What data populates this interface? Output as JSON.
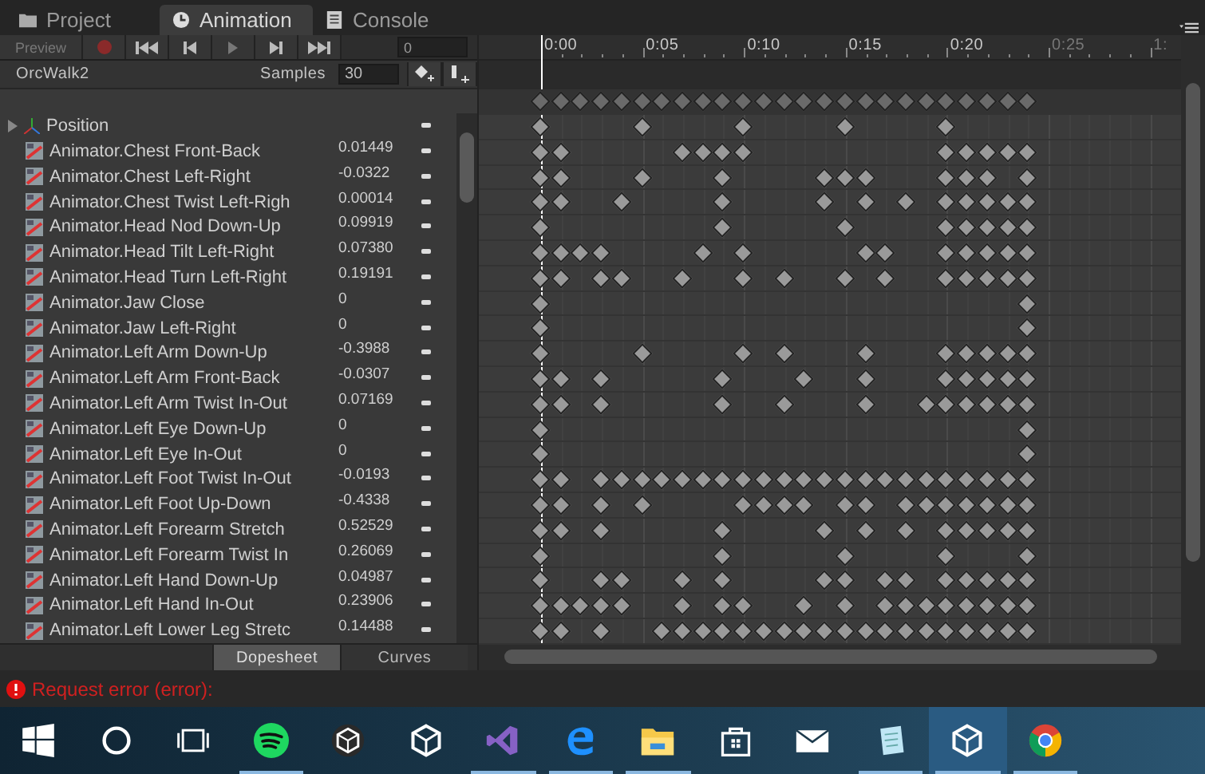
{
  "tabs": [
    {
      "label": "Project",
      "selected": false
    },
    {
      "label": "Animation",
      "selected": true
    },
    {
      "label": "Console",
      "selected": false
    }
  ],
  "toolbar": {
    "preview": "Preview",
    "frame": "0"
  },
  "clip": {
    "name": "OrcWalk2",
    "samples_label": "Samples",
    "samples": "30"
  },
  "ruler": [
    {
      "label": "0:00",
      "dim": false
    },
    {
      "label": "0:05",
      "dim": false
    },
    {
      "label": "0:10",
      "dim": false
    },
    {
      "label": "0:15",
      "dim": false
    },
    {
      "label": "0:20",
      "dim": false
    },
    {
      "label": "0:25",
      "dim": true
    },
    {
      "label": "1:",
      "dim": true
    }
  ],
  "summary_keys": [
    true,
    true,
    true,
    true,
    true,
    true,
    true,
    true,
    true,
    true,
    true,
    true,
    true,
    true,
    true,
    true,
    true,
    true,
    true,
    true,
    true,
    true,
    true,
    true,
    true
  ],
  "properties": [
    {
      "kind": "group",
      "name": "Position",
      "keys": [
        true,
        false,
        false,
        false,
        false,
        true,
        false,
        false,
        false,
        false,
        true,
        false,
        false,
        false,
        false,
        true,
        false,
        false,
        false,
        false,
        true,
        false,
        false,
        false,
        false
      ]
    },
    {
      "kind": "curve",
      "name": "Animator.Chest Front-Back",
      "value": "0.01449",
      "keys": [
        true,
        true,
        false,
        false,
        false,
        false,
        false,
        true,
        true,
        true,
        true,
        false,
        false,
        false,
        false,
        false,
        false,
        false,
        false,
        false,
        true,
        true,
        true,
        true,
        true
      ]
    },
    {
      "kind": "curve",
      "name": "Animator.Chest Left-Right",
      "value": "-0.0322",
      "keys": [
        true,
        true,
        false,
        false,
        false,
        true,
        false,
        false,
        false,
        true,
        false,
        false,
        false,
        false,
        true,
        true,
        true,
        false,
        false,
        false,
        true,
        true,
        true,
        false,
        true
      ]
    },
    {
      "kind": "curve",
      "name": "Animator.Chest Twist Left-Righ",
      "value": "0.00014",
      "keys": [
        true,
        true,
        false,
        false,
        true,
        false,
        false,
        false,
        false,
        true,
        false,
        false,
        false,
        false,
        true,
        false,
        true,
        false,
        true,
        false,
        true,
        true,
        true,
        true,
        true
      ]
    },
    {
      "kind": "curve",
      "name": "Animator.Head Nod Down-Up",
      "value": "0.09919",
      "keys": [
        true,
        false,
        false,
        false,
        false,
        false,
        false,
        false,
        false,
        true,
        false,
        false,
        false,
        false,
        false,
        true,
        false,
        false,
        false,
        false,
        true,
        true,
        true,
        true,
        true
      ]
    },
    {
      "kind": "curve",
      "name": "Animator.Head Tilt Left-Right",
      "value": "0.07380",
      "keys": [
        true,
        true,
        true,
        true,
        false,
        false,
        false,
        false,
        true,
        false,
        true,
        false,
        false,
        false,
        false,
        false,
        true,
        true,
        false,
        false,
        true,
        true,
        true,
        true,
        true
      ]
    },
    {
      "kind": "curve",
      "name": "Animator.Head Turn Left-Right",
      "value": "0.19191",
      "keys": [
        true,
        true,
        false,
        true,
        true,
        false,
        false,
        true,
        false,
        false,
        true,
        false,
        true,
        false,
        false,
        true,
        false,
        true,
        false,
        false,
        true,
        true,
        true,
        true,
        true
      ]
    },
    {
      "kind": "curve",
      "name": "Animator.Jaw Close",
      "value": "0",
      "keys": [
        true,
        false,
        false,
        false,
        false,
        false,
        false,
        false,
        false,
        false,
        false,
        false,
        false,
        false,
        false,
        false,
        false,
        false,
        false,
        false,
        false,
        false,
        false,
        false,
        true
      ]
    },
    {
      "kind": "curve",
      "name": "Animator.Jaw Left-Right",
      "value": "0",
      "keys": [
        true,
        false,
        false,
        false,
        false,
        false,
        false,
        false,
        false,
        false,
        false,
        false,
        false,
        false,
        false,
        false,
        false,
        false,
        false,
        false,
        false,
        false,
        false,
        false,
        true
      ]
    },
    {
      "kind": "curve",
      "name": "Animator.Left Arm Down-Up",
      "value": "-0.3988",
      "keys": [
        true,
        false,
        false,
        false,
        false,
        true,
        false,
        false,
        false,
        false,
        true,
        false,
        true,
        false,
        false,
        false,
        true,
        false,
        false,
        false,
        true,
        true,
        true,
        true,
        true
      ]
    },
    {
      "kind": "curve",
      "name": "Animator.Left Arm Front-Back",
      "value": "-0.0307",
      "keys": [
        true,
        true,
        false,
        true,
        false,
        false,
        false,
        false,
        false,
        true,
        false,
        false,
        false,
        true,
        false,
        false,
        true,
        false,
        false,
        false,
        true,
        true,
        true,
        true,
        true
      ]
    },
    {
      "kind": "curve",
      "name": "Animator.Left Arm Twist In-Out",
      "value": "0.07169",
      "keys": [
        true,
        true,
        false,
        true,
        false,
        false,
        false,
        false,
        false,
        true,
        false,
        false,
        true,
        false,
        false,
        false,
        true,
        false,
        false,
        true,
        true,
        true,
        true,
        true,
        true
      ]
    },
    {
      "kind": "curve",
      "name": "Animator.Left Eye Down-Up",
      "value": "0",
      "keys": [
        true,
        false,
        false,
        false,
        false,
        false,
        false,
        false,
        false,
        false,
        false,
        false,
        false,
        false,
        false,
        false,
        false,
        false,
        false,
        false,
        false,
        false,
        false,
        false,
        true
      ]
    },
    {
      "kind": "curve",
      "name": "Animator.Left Eye In-Out",
      "value": "0",
      "keys": [
        true,
        false,
        false,
        false,
        false,
        false,
        false,
        false,
        false,
        false,
        false,
        false,
        false,
        false,
        false,
        false,
        false,
        false,
        false,
        false,
        false,
        false,
        false,
        false,
        true
      ]
    },
    {
      "kind": "curve",
      "name": "Animator.Left Foot Twist In-Out",
      "value": "-0.0193",
      "keys": [
        true,
        true,
        false,
        true,
        true,
        true,
        true,
        true,
        true,
        true,
        true,
        true,
        true,
        true,
        true,
        true,
        true,
        true,
        true,
        true,
        true,
        true,
        true,
        true,
        true
      ]
    },
    {
      "kind": "curve",
      "name": "Animator.Left Foot Up-Down",
      "value": "-0.4338",
      "keys": [
        true,
        true,
        false,
        true,
        false,
        true,
        false,
        false,
        false,
        false,
        true,
        true,
        true,
        true,
        false,
        true,
        true,
        false,
        true,
        true,
        true,
        true,
        true,
        true,
        true
      ]
    },
    {
      "kind": "curve",
      "name": "Animator.Left Forearm Stretch",
      "value": "0.52529",
      "keys": [
        true,
        true,
        false,
        true,
        false,
        false,
        false,
        false,
        false,
        true,
        false,
        false,
        false,
        false,
        true,
        false,
        true,
        false,
        true,
        false,
        true,
        true,
        true,
        true,
        true
      ]
    },
    {
      "kind": "curve",
      "name": "Animator.Left Forearm Twist In",
      "value": "0.26069",
      "keys": [
        true,
        false,
        false,
        false,
        false,
        false,
        false,
        false,
        false,
        true,
        false,
        false,
        false,
        false,
        false,
        true,
        false,
        false,
        false,
        false,
        true,
        false,
        false,
        false,
        true
      ]
    },
    {
      "kind": "curve",
      "name": "Animator.Left Hand Down-Up",
      "value": "0.04987",
      "keys": [
        true,
        false,
        false,
        true,
        true,
        false,
        false,
        true,
        false,
        true,
        false,
        false,
        false,
        false,
        true,
        true,
        false,
        true,
        true,
        false,
        true,
        true,
        true,
        true,
        true
      ]
    },
    {
      "kind": "curve",
      "name": "Animator.Left Hand In-Out",
      "value": "0.23906",
      "keys": [
        true,
        true,
        true,
        true,
        true,
        false,
        false,
        true,
        false,
        true,
        true,
        false,
        false,
        true,
        false,
        true,
        false,
        true,
        true,
        true,
        true,
        true,
        true,
        true,
        true
      ]
    },
    {
      "kind": "curve",
      "name": "Animator.Left Lower Leg Stretc",
      "value": "0.14488",
      "keys": [
        true,
        true,
        false,
        true,
        false,
        false,
        true,
        true,
        true,
        true,
        true,
        true,
        true,
        true,
        true,
        true,
        true,
        true,
        true,
        true,
        true,
        true,
        true,
        true,
        true
      ]
    }
  ],
  "view_tabs": [
    {
      "label": "Dopesheet",
      "selected": true
    },
    {
      "label": "Curves",
      "selected": false
    }
  ],
  "status": {
    "message": "Request error (error):"
  },
  "taskbar": [
    {
      "kind": "start",
      "running": false,
      "active": false
    },
    {
      "kind": "search",
      "running": false,
      "active": false
    },
    {
      "kind": "taskview",
      "running": false,
      "active": false
    },
    {
      "kind": "music",
      "running": true,
      "active": false
    },
    {
      "kind": "cube-dark",
      "running": false,
      "active": false
    },
    {
      "kind": "cube",
      "running": false,
      "active": false
    },
    {
      "kind": "editor",
      "running": true,
      "active": false
    },
    {
      "kind": "edge",
      "running": true,
      "active": false
    },
    {
      "kind": "folder",
      "running": true,
      "active": false
    },
    {
      "kind": "store",
      "running": false,
      "active": false
    },
    {
      "kind": "mail",
      "running": false,
      "active": false
    },
    {
      "kind": "notepad",
      "running": true,
      "active": false
    },
    {
      "kind": "cube",
      "running": true,
      "active": true
    },
    {
      "kind": "chrome",
      "running": true,
      "active": false
    }
  ]
}
